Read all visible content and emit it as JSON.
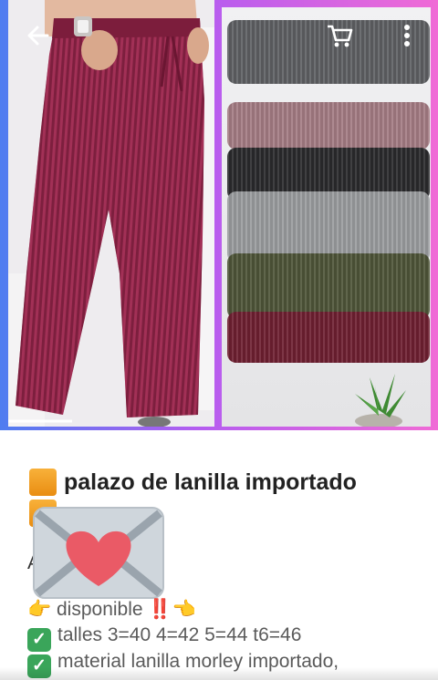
{
  "topbar": {
    "back_icon": "arrow-left-icon",
    "cart_icon": "cart-icon",
    "menu_icon": "more-vertical-icon"
  },
  "hero": {
    "left_photo": "maroon ribbed palazzo pants",
    "right_photo": "stack of folded ribbed knit pants in six colors"
  },
  "post": {
    "title": "palazo de lanilla importado",
    "line3_prefix": "A",
    "line4": "disponible",
    "line4_emoji_pre": "👉",
    "line4_emoji_mid": "‼️",
    "line4_emoji_post": "👈",
    "line5": "talles 3=40 4=42 5=44 t6=46",
    "line6": "material lanilla morley  importado,"
  },
  "colors": {
    "gradient_start": "#4f7df0",
    "gradient_end": "#f06bd6",
    "check_green": "#3aa55a",
    "square_orange": "#f0a026",
    "heart": "#ea5a66"
  }
}
